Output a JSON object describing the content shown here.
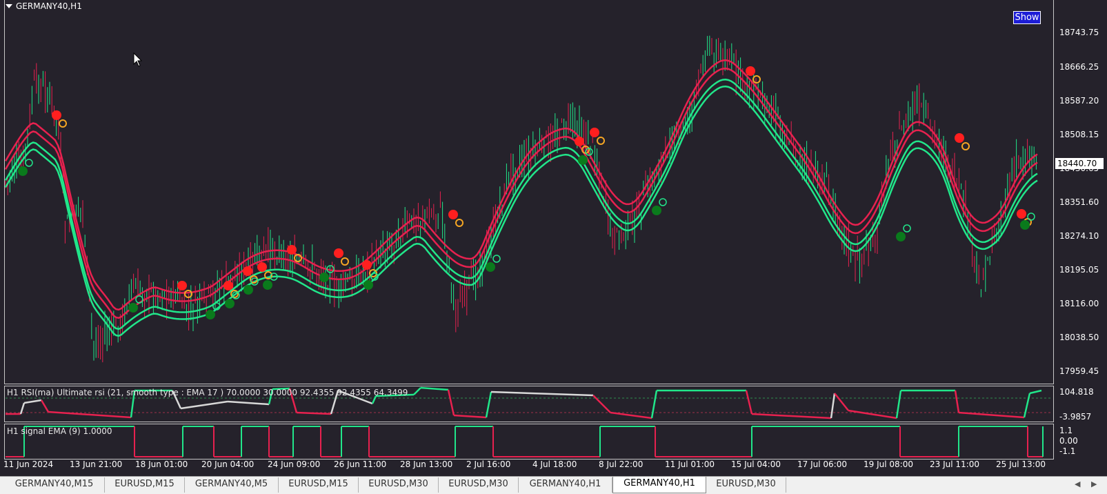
{
  "chart": {
    "symbol_title": "GERMANY40,H1",
    "show_button": "Show",
    "current_price": "18440.70",
    "price_labels": [
      "18743.75",
      "18666.25",
      "18587.20",
      "18508.15",
      "18430.65",
      "18351.60",
      "18274.10",
      "18195.05",
      "18116.00",
      "18038.50",
      "17959.45"
    ],
    "time_labels": [
      "11 Jun 2024",
      "13 Jun 21:00",
      "18 Jun 01:00",
      "20 Jun 04:00",
      "24 Jun 09:00",
      "26 Jun 11:00",
      "28 Jun 13:00",
      "2 Jul 16:00",
      "4 Jul 18:00",
      "8 Jul 22:00",
      "11 Jul 01:00",
      "15 Jul 04:00",
      "17 Jul 06:00",
      "19 Jul 08:00",
      "23 Jul 11:00",
      "25 Jul 13:00"
    ]
  },
  "rsi_pane": {
    "title": "H1 RSI(ma) Ultimate rsi (21, smooth type : EMA  17 ) 70.0000 30.0000 92.4355 92.4355 64.3499",
    "labels": [
      "104.818",
      "-3.9857"
    ]
  },
  "signal_pane": {
    "title": "H1 signal EMA (9) 1.0000",
    "labels": [
      "1.1",
      "0.00",
      "-1.1"
    ]
  },
  "tabs": [
    {
      "label": "GERMANY40,M15",
      "active": false
    },
    {
      "label": "EURUSD,M15",
      "active": false
    },
    {
      "label": "GERMANY40,M5",
      "active": false
    },
    {
      "label": "EURUSD,M15",
      "active": false
    },
    {
      "label": "EURUSD,M30",
      "active": false
    },
    {
      "label": "EURUSD,M30",
      "active": false
    },
    {
      "label": "GERMANY40,H1",
      "active": false
    },
    {
      "label": "GERMANY40,H1",
      "active": true
    },
    {
      "label": "EURUSD,M30",
      "active": false
    }
  ],
  "colors": {
    "background": "#25222b",
    "bull": "#21e68a",
    "bear": "#e8214f",
    "buy_dot": "#0a7a1c",
    "sell_dot": "#ff1f1f",
    "arrow": "#f5a623"
  },
  "icons": {
    "scroll_left": "triangle-left-icon",
    "scroll_right": "triangle-right-icon"
  }
}
